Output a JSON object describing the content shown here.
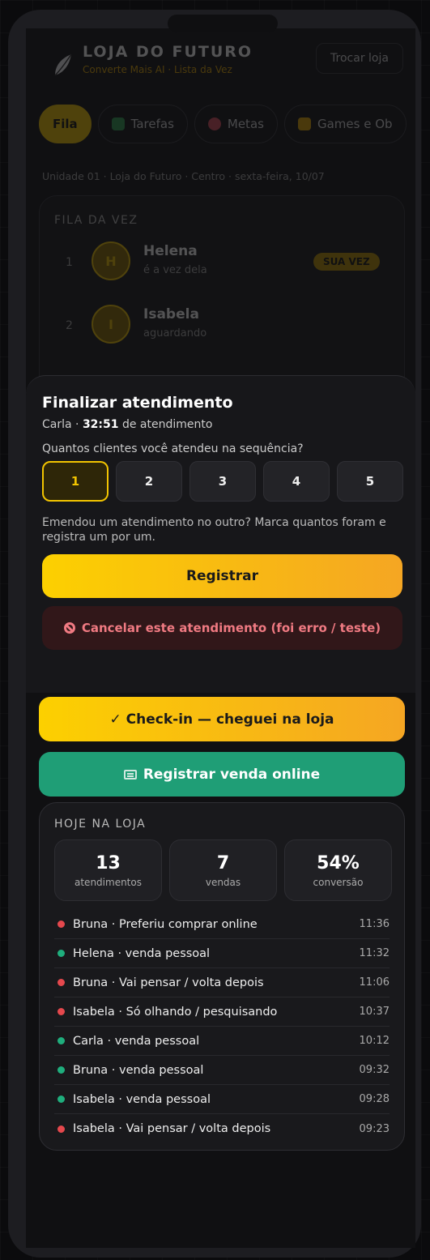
{
  "header": {
    "brand_title": "LOJA DO FUTURO",
    "brand_subtitle": "Converte Mais AI · Lista da Vez",
    "switch_store": "Trocar loja"
  },
  "tabs": [
    {
      "label": "Fila",
      "icon": "none",
      "active": true
    },
    {
      "label": "Tarefas",
      "icon": "check-box-icon"
    },
    {
      "label": "Metas",
      "icon": "target-icon"
    },
    {
      "label": "Games e Ob",
      "icon": "trophy-icon"
    }
  ],
  "unit_line": "Unidade 01 · Loja do Futuro · Centro · sexta-feira, 10/07",
  "queue": {
    "title": "FILA DA VEZ",
    "rows": [
      {
        "pos": "1",
        "initial": "H",
        "name": "Helena",
        "status": "é a vez dela",
        "badge": "SUA VEZ"
      },
      {
        "pos": "2",
        "initial": "I",
        "name": "Isabela",
        "status": "aguardando"
      }
    ]
  },
  "sheet": {
    "title": "Finalizar atendimento",
    "attendant": "Carla · ",
    "timer": "32:51",
    "timer_suffix": " de atendimento",
    "question": "Quantos clientes você atendeu na sequência?",
    "options": [
      "1",
      "2",
      "3",
      "4",
      "5"
    ],
    "selected": "1",
    "hint": "Emendou um atendimento no outro? Marca quantos foram e registra um por um.",
    "register": "Registrar",
    "cancel": "Cancelar este atendimento (foi erro / teste)"
  },
  "actions": {
    "checkin": "✓ Check-in — cheguei na loja",
    "online_sale": "Registrar venda online"
  },
  "today": {
    "title": "HOJE NA LOJA",
    "stats": [
      {
        "value": "13",
        "label": "atendimentos"
      },
      {
        "value": "7",
        "label": "vendas"
      },
      {
        "value": "54%",
        "label": "conversão"
      }
    ],
    "events": [
      {
        "text": "Bruna · Preferiu comprar online",
        "time": "11:36",
        "color": "#e5484d"
      },
      {
        "text": "Helena · venda pessoal",
        "time": "11:32",
        "color": "#1fae7d"
      },
      {
        "text": "Bruna · Vai pensar / volta depois",
        "time": "11:06",
        "color": "#e5484d"
      },
      {
        "text": "Isabela · Só olhando / pesquisando",
        "time": "10:37",
        "color": "#e5484d"
      },
      {
        "text": "Carla · venda pessoal",
        "time": "10:12",
        "color": "#1fae7d"
      },
      {
        "text": "Bruna · venda pessoal",
        "time": "09:32",
        "color": "#1fae7d"
      },
      {
        "text": "Isabela · venda pessoal",
        "time": "09:28",
        "color": "#1fae7d"
      },
      {
        "text": "Isabela · Vai pensar / volta depois",
        "time": "09:23",
        "color": "#e5484d"
      }
    ]
  }
}
